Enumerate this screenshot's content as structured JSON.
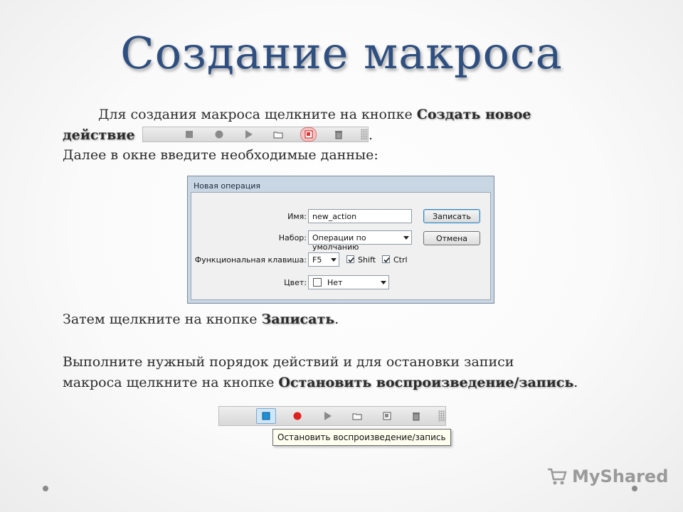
{
  "slide": {
    "title": "Создание макроса",
    "para1_line1": "Для создания макроса щелкните на кнопке ",
    "para1_hl1": "Создать новое",
    "para1_hl2": "действие",
    "para1_end": " .",
    "para2": "Далее в окне введите необходимые данные:",
    "para3_text": "Затем щелкните на кнопке ",
    "para3_hl": "Записать",
    "para3_end": ".",
    "para4_line1": "Выполните нужный порядок действий и для остановки записи",
    "para4_line2": "макроса щелкните на кнопке ",
    "para4_hl": "Остановить воспроизведение/запись",
    "para4_end": "."
  },
  "dialog": {
    "title": "Новая операция",
    "name_label": "Имя:",
    "name_value": "new_action",
    "set_label": "Набор:",
    "set_value": "Операции по умолчанию",
    "fkey_label": "Функциональная клавиша:",
    "fkey_value": "F5",
    "shift_label": "Shift",
    "ctrl_label": "Ctrl",
    "color_label": "Цвет:",
    "color_value": "Нет",
    "record_button": "Записать",
    "cancel_button": "Отмена"
  },
  "tooltip": "Остановить воспроизведение/запись",
  "logo": "MyShared",
  "colors": {
    "title": "#2e4f80",
    "record_red": "#e02020",
    "stop_blue": "#1f8fd6"
  }
}
